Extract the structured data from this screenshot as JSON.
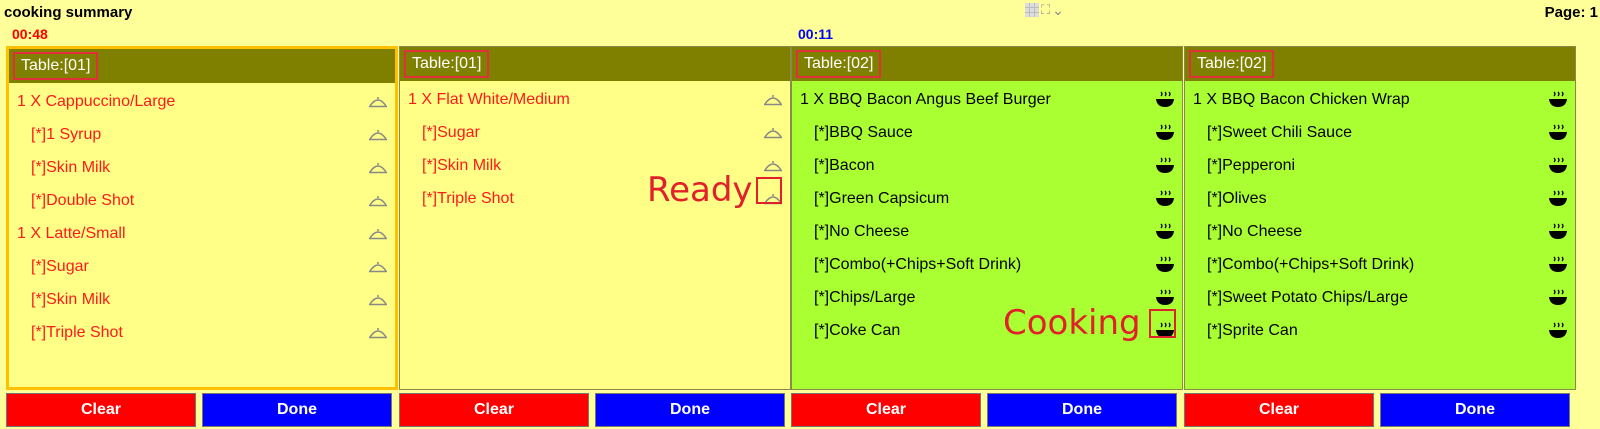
{
  "header": {
    "title": "cooking summary",
    "page_label": "Page:  1"
  },
  "cards": [
    {
      "timer": "00:48",
      "timer_color": "#ff0000",
      "table": "Table:[01]",
      "status": "ready",
      "items": [
        {
          "text": "1 X  Cappuccino/Large",
          "type": "main"
        },
        {
          "text": "[*]1 Syrup",
          "type": "mod"
        },
        {
          "text": "[*]Skin Milk",
          "type": "mod"
        },
        {
          "text": "[*]Double Shot",
          "type": "mod"
        },
        {
          "text": "1 X  Latte/Small",
          "type": "main"
        },
        {
          "text": "[*]Sugar",
          "type": "mod"
        },
        {
          "text": "[*]Skin Milk",
          "type": "mod"
        },
        {
          "text": "[*]Triple Shot",
          "type": "mod"
        }
      ],
      "clear_label": "Clear",
      "done_label": "Done"
    },
    {
      "timer": "",
      "table": "Table:[01]",
      "status": "ready",
      "items": [
        {
          "text": "1 X  Flat White/Medium",
          "type": "main"
        },
        {
          "text": "[*]Sugar",
          "type": "mod"
        },
        {
          "text": "[*]Skin Milk",
          "type": "mod"
        },
        {
          "text": "[*]Triple Shot",
          "type": "mod"
        }
      ],
      "clear_label": "Clear",
      "done_label": "Done"
    },
    {
      "timer": "00:11",
      "timer_color": "#0000ff",
      "table": "Table:[02]",
      "status": "cooking",
      "items": [
        {
          "text": "1 X  BBQ Bacon Angus Beef Burger",
          "type": "main"
        },
        {
          "text": "[*]BBQ Sauce",
          "type": "mod"
        },
        {
          "text": "[*]Bacon",
          "type": "mod"
        },
        {
          "text": "[*]Green Capsicum",
          "type": "mod"
        },
        {
          "text": "[*]No Cheese",
          "type": "mod"
        },
        {
          "text": "[*]Combo(+Chips+Soft Drink)",
          "type": "mod"
        },
        {
          "text": "[*]Chips/Large",
          "type": "mod"
        },
        {
          "text": "[*]Coke Can",
          "type": "mod"
        }
      ],
      "clear_label": "Clear",
      "done_label": "Done"
    },
    {
      "timer": "",
      "table": "Table:[02]",
      "status": "cooking",
      "items": [
        {
          "text": "1 X  BBQ Bacon Chicken Wrap",
          "type": "main"
        },
        {
          "text": "[*]Sweet Chili Sauce",
          "type": "mod"
        },
        {
          "text": "[*]Pepperoni",
          "type": "mod"
        },
        {
          "text": "[*]Olives",
          "type": "mod"
        },
        {
          "text": "[*]No Cheese",
          "type": "mod"
        },
        {
          "text": "[*]Combo(+Chips+Soft Drink)",
          "type": "mod"
        },
        {
          "text": "[*]Sweet Potato Chips/Large",
          "type": "mod"
        },
        {
          "text": "[*]Sprite Can",
          "type": "mod"
        }
      ],
      "clear_label": "Clear",
      "done_label": "Done"
    }
  ],
  "annotations": {
    "ready_label": "Ready",
    "cooking_label": "Cooking"
  },
  "icons": {
    "ready": "cloche-icon",
    "cooking": "steaming-bowl-icon",
    "view": [
      "grid-icon",
      "expand-icon",
      "chevron-down-icon"
    ]
  }
}
